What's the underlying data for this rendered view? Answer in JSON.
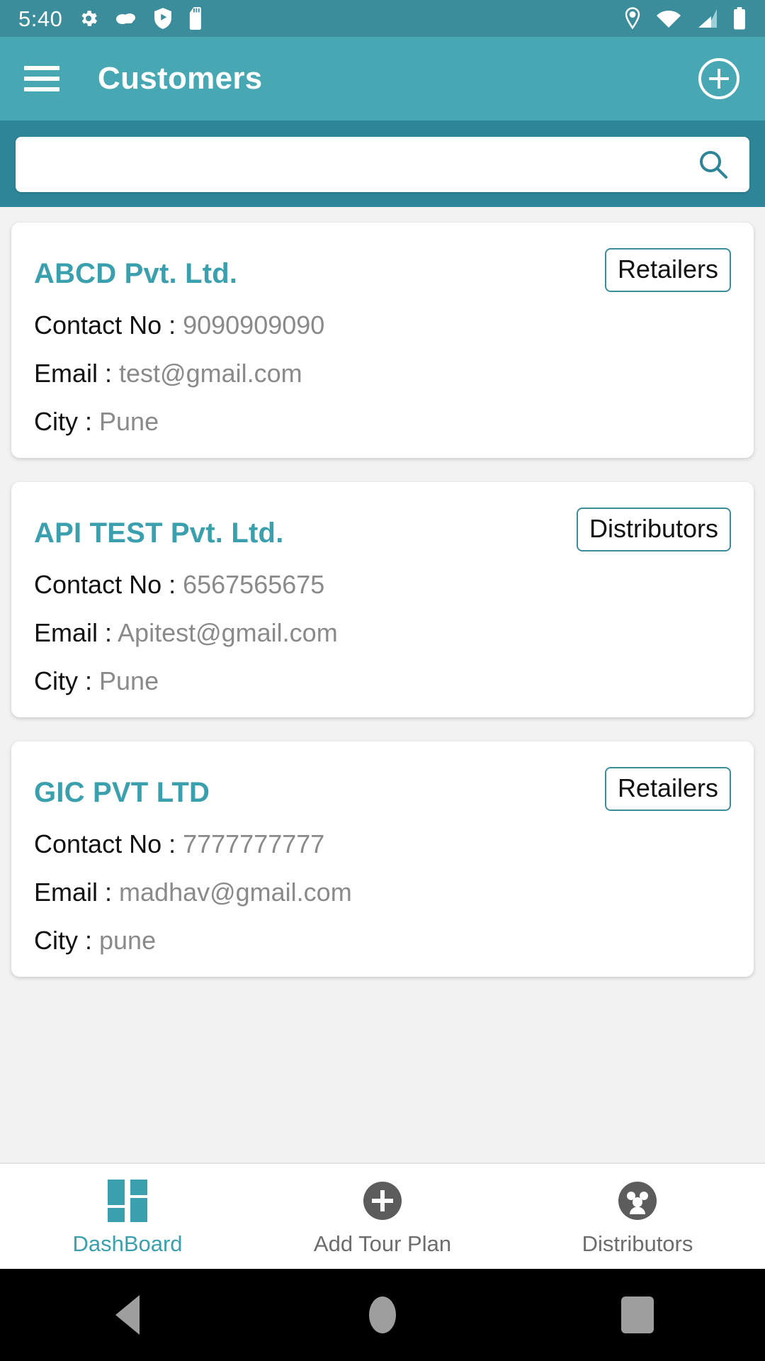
{
  "status_bar": {
    "time": "5:40",
    "left_icons": [
      "gear-icon",
      "cloud-icon",
      "shield-play-icon",
      "sd-card-icon"
    ],
    "right_icons": [
      "location-pin-icon",
      "wifi-icon",
      "cellular-signal-icon",
      "battery-icon"
    ]
  },
  "appbar": {
    "menu_icon": "hamburger-menu-icon",
    "title": "Customers",
    "add_icon": "add-circle-icon"
  },
  "search": {
    "value": "",
    "placeholder": "",
    "icon": "search-icon"
  },
  "customers": [
    {
      "name": "ABCD Pvt. Ltd.",
      "badge": "Retailers",
      "contact_label": "Contact No : ",
      "contact_value": "9090909090",
      "email_label": "Email : ",
      "email_value": "test@gmail.com",
      "city_label": "City : ",
      "city_value": "Pune"
    },
    {
      "name": "API TEST Pvt. Ltd.",
      "badge": "Distributors",
      "contact_label": "Contact No : ",
      "contact_value": "6567565675",
      "email_label": "Email : ",
      "email_value": "Apitest@gmail.com",
      "city_label": "City : ",
      "city_value": "Pune"
    },
    {
      "name": "GIC PVT LTD",
      "badge": "Retailers",
      "contact_label": "Contact No : ",
      "contact_value": "7777777777",
      "email_label": "Email : ",
      "email_value": "madhav@gmail.com",
      "city_label": "City : ",
      "city_value": "pune"
    }
  ],
  "bottom_nav": [
    {
      "label": "DashBoard",
      "icon": "dashboard-grid-icon",
      "active": true
    },
    {
      "label": "Add Tour Plan",
      "icon": "add-circle-filled-icon",
      "active": false
    },
    {
      "label": "Distributors",
      "icon": "people-group-icon",
      "active": false
    }
  ],
  "android_nav": {
    "back": "back-triangle-icon",
    "home": "home-circle-icon",
    "recents": "recents-square-icon"
  },
  "colors": {
    "status_bar": "#3B8D9B",
    "appbar": "#47A8B4",
    "search_strip": "#2E8597",
    "accent": "#3BA0AD",
    "page_background": "#f2f2f2",
    "value_text": "#8a8a8a"
  }
}
